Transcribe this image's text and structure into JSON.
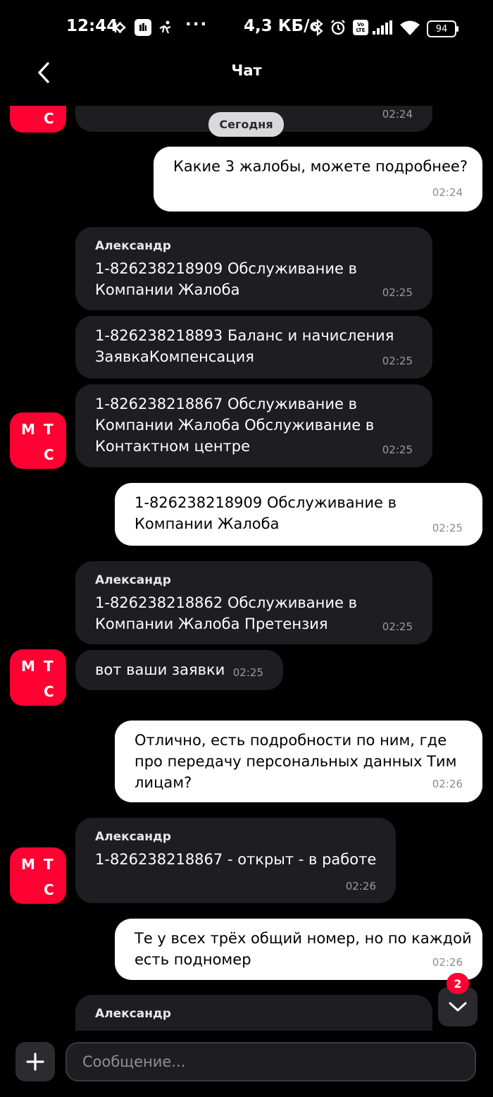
{
  "status_bar": {
    "time": "12:44",
    "network_speed": "4,3 КБ/с",
    "battery": "94",
    "volte": "Vo LTE",
    "more": "···",
    "icons": [
      "nfc-icon",
      "app-icon",
      "running-icon",
      "bluetooth-icon",
      "alarm-icon",
      "volte-icon",
      "signal-icon",
      "wifi-icon",
      "battery-icon"
    ]
  },
  "header": {
    "title": "Чат",
    "back_icon": "chevron-left-icon"
  },
  "chat": {
    "date_divider": "Сегодня",
    "avatar_logo": [
      "М",
      "Т",
      "С"
    ],
    "messages": [
      {
        "dir": "in",
        "time": "02:24"
      },
      {
        "dir": "out",
        "text": "Какие 3 жалобы, можете подробнее?",
        "time": "02:24"
      },
      {
        "dir": "in",
        "sender": "Александр",
        "text": "1-826238218909 Обслуживание в\nКомпании Жалоба",
        "time": "02:25"
      },
      {
        "dir": "in",
        "text": "1-826238218893  Баланс и начисления\nЗаявкаКомпенсация",
        "time": "02:25"
      },
      {
        "dir": "in",
        "text": "1-826238218867  Обслуживание в\nКомпании Жалоба Обслуживание в\nКонтактном центре",
        "time": "02:25"
      },
      {
        "dir": "out",
        "text": "1-826238218909 Обслуживание в\nКомпании Жалоба",
        "time": "02:25"
      },
      {
        "dir": "in",
        "sender": "Александр",
        "text": "1-826238218862  Обслуживание в\nКомпании Жалоба Претензия",
        "time": "02:25"
      },
      {
        "dir": "in",
        "text": "вот ваши заявки",
        "time": "02:25"
      },
      {
        "dir": "out",
        "text": "Отлично, есть подробности по ним, где\nпро передачу персональных данных Тим\nлицам?",
        "time": "02:26"
      },
      {
        "dir": "in",
        "sender": "Александр",
        "text": "1-826238218867 - открыт - в работе",
        "time": "02:26"
      },
      {
        "dir": "out",
        "text": "Те у всех трёх общий номер, но по каждой\nесть подномер",
        "time": "02:26"
      },
      {
        "dir": "in",
        "sender": "Александр"
      }
    ],
    "unread_count": "2",
    "scroll_icon": "chevron-down-icon"
  },
  "composer": {
    "placeholder": "Сообщение...",
    "add_icon": "plus-icon"
  },
  "colors": {
    "background": "#000000",
    "incoming_bubble": "#1d1d22",
    "outgoing_bubble": "#ffffff",
    "brand_red": "#ff0032"
  }
}
